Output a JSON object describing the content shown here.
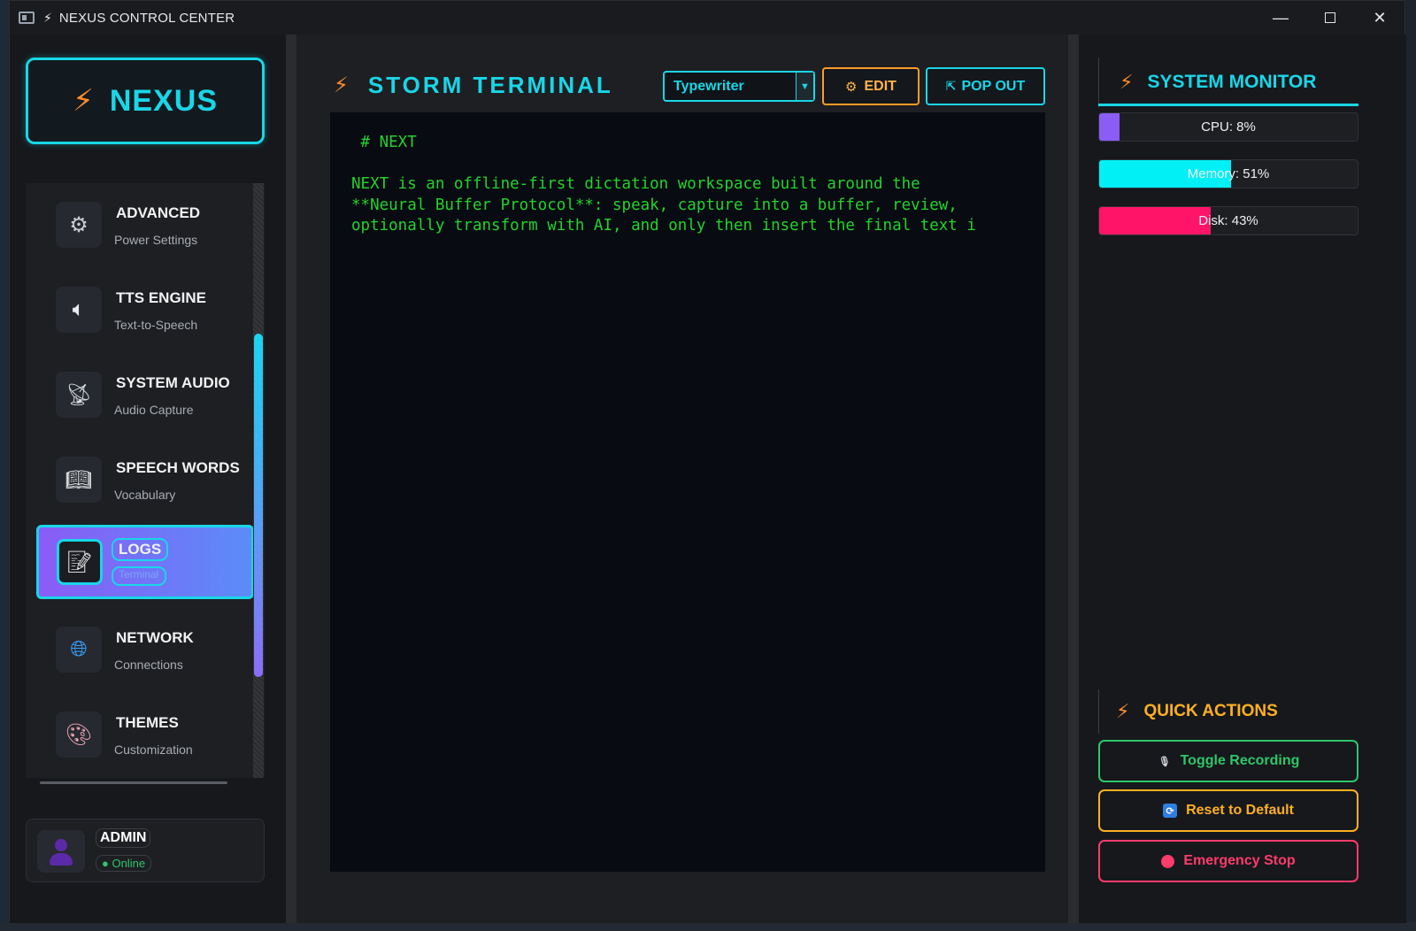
{
  "window": {
    "title": "NEXUS CONTROL CENTER",
    "controls": [
      "minimize",
      "maximize",
      "close"
    ]
  },
  "sidebar": {
    "logo_text": "NEXUS",
    "items": [
      {
        "title": "ADVANCED",
        "subtitle": "Power Settings",
        "icon": "gear-icon"
      },
      {
        "title": "TTS ENGINE",
        "subtitle": "Text-to-Speech",
        "icon": "speaker-icon"
      },
      {
        "title": "SYSTEM AUDIO",
        "subtitle": "Audio Capture",
        "icon": "satellite-dish-icon"
      },
      {
        "title": "SPEECH WORDS",
        "subtitle": "Vocabulary",
        "icon": "book-icon"
      },
      {
        "title": "LOGS",
        "subtitle": "Terminal",
        "icon": "document-icon",
        "active": true
      },
      {
        "title": "NETWORK",
        "subtitle": "Connections",
        "icon": "globe-icon"
      },
      {
        "title": "THEMES",
        "subtitle": "Customization",
        "icon": "palette-icon"
      }
    ],
    "user": {
      "name": "ADMIN",
      "status": "Online"
    }
  },
  "main": {
    "title": "STORM TERMINAL",
    "mode_select": {
      "value": "Typewriter"
    },
    "edit_label": "EDIT",
    "popout_label": "POP OUT",
    "terminal_text": " # NEXT\n\nNEXT is an offline-first dictation workspace built around the\n**Neural Buffer Protocol**: speak, capture into a buffer, review,\noptionally transform with AI, and only then insert the final text i"
  },
  "monitor": {
    "title": "SYSTEM MONITOR",
    "meters": [
      {
        "label": "CPU: 8%",
        "value": 8,
        "color": "#8b5cf6"
      },
      {
        "label": "Memory: 51%",
        "value": 51,
        "color": "#00f0f5"
      },
      {
        "label": "Disk: 43%",
        "value": 43,
        "color": "#ff1468"
      }
    ]
  },
  "quick_actions": {
    "title": "QUICK ACTIONS",
    "buttons": [
      {
        "label": "Toggle Recording",
        "color": "#2ec66a",
        "icon": "microphone-icon"
      },
      {
        "label": "Reset to Default",
        "color": "#ffb020",
        "icon": "refresh-icon"
      },
      {
        "label": "Emergency Stop",
        "color": "#ff3b6b",
        "icon": "stop-icon"
      }
    ]
  },
  "colors": {
    "accent": "#19d6e8",
    "bolt": "#ff8a2a",
    "terminal_text": "#22d32c",
    "quick_actions_title": "#ffb020"
  }
}
